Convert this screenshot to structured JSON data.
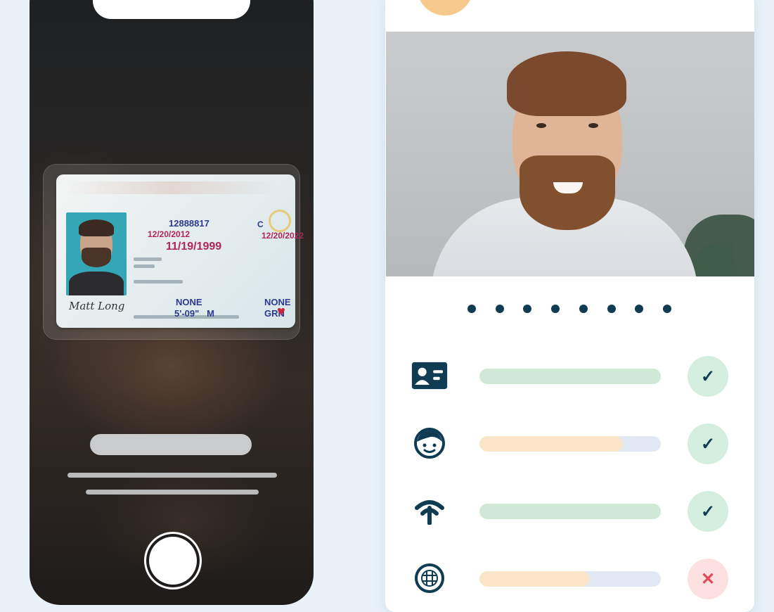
{
  "id_card": {
    "license_number": "12888817",
    "class": "C",
    "issued": "12/20/2012",
    "expires": "12/20/2022",
    "dob": "11/19/1999",
    "restrictions": "NONE",
    "endorsements": "NONE",
    "height": "5'-09\"",
    "sex": "M",
    "eyes": "GRN",
    "signature": "Matt Long"
  },
  "checks": [
    {
      "icon": "id-card-icon",
      "fill": 1.0,
      "color": "#cfe9d6",
      "status": "pass",
      "mark": "✓"
    },
    {
      "icon": "face-icon",
      "fill": 0.79,
      "color": "#fbe5c8",
      "status": "pass",
      "mark": "✓"
    },
    {
      "icon": "signal-icon",
      "fill": 1.0,
      "color": "#cfe9d6",
      "status": "pass",
      "mark": "✓"
    },
    {
      "icon": "globe-icon",
      "fill": 0.61,
      "color": "#fbe5c8",
      "status": "fail",
      "mark": "✕"
    }
  ],
  "colors": {
    "background": "#e9f2f9",
    "accent_dark": "#0f3b53",
    "pass": "#d4efe0",
    "fail": "#fde1e1"
  }
}
